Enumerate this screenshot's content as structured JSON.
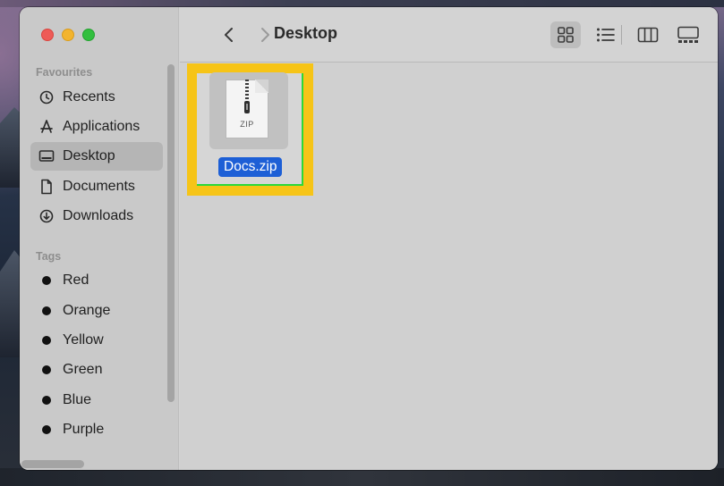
{
  "window": {
    "title": "Desktop"
  },
  "sidebar": {
    "favourites_title": "Favourites",
    "favourites": [
      {
        "label": "Recents",
        "icon": "clock-icon"
      },
      {
        "label": "Applications",
        "icon": "applications-icon"
      },
      {
        "label": "Desktop",
        "icon": "desktop-icon",
        "selected": true
      },
      {
        "label": "Documents",
        "icon": "document-icon"
      },
      {
        "label": "Downloads",
        "icon": "download-icon"
      }
    ],
    "tags_title": "Tags",
    "tags": [
      {
        "label": "Red"
      },
      {
        "label": "Orange"
      },
      {
        "label": "Yellow"
      },
      {
        "label": "Green"
      },
      {
        "label": "Blue"
      },
      {
        "label": "Purple"
      }
    ]
  },
  "toolbar": {
    "back_icon": "chevron-left-icon",
    "forward_icon": "chevron-right-icon",
    "views": [
      {
        "name": "icon-view",
        "icon": "grid-icon",
        "active": true
      },
      {
        "name": "list-view",
        "icon": "list-icon",
        "active": false
      },
      {
        "name": "column-view",
        "icon": "columns-icon",
        "active": false
      },
      {
        "name": "gallery-view",
        "icon": "gallery-icon",
        "active": false
      }
    ]
  },
  "files": [
    {
      "name": "Docs.zip",
      "type_label": "ZIP",
      "selected": true
    }
  ],
  "colors": {
    "highlight": "#f6c417",
    "selection": "#1d5fd6",
    "close": "#ee5b57",
    "minimize": "#f3b42e",
    "zoom": "#33bf3f"
  }
}
